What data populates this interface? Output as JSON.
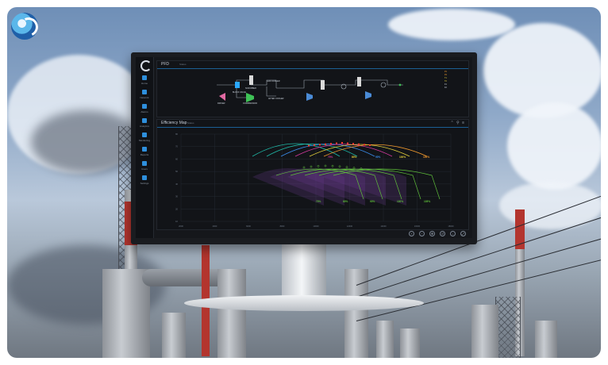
{
  "app": {
    "panels": {
      "pfd": {
        "title": "PFD",
        "subtitle": "Status"
      },
      "efficiency": {
        "title": "Efficiency Map",
        "subtitle": "Status"
      }
    },
    "sidebar": {
      "items": [
        {
          "label": "Home",
          "icon": "home-icon"
        },
        {
          "label": "Network",
          "icon": "network-icon"
        },
        {
          "label": "Alarms",
          "icon": "alarm-icon"
        },
        {
          "label": "Analytics",
          "icon": "chart-icon"
        },
        {
          "label": "Monitoring",
          "icon": "monitor-icon"
        },
        {
          "label": "Reports",
          "icon": "report-icon"
        },
        {
          "label": "Users",
          "icon": "user-icon"
        },
        {
          "label": "Settings",
          "icon": "gear-icon"
        }
      ]
    },
    "pfd_labels": {
      "block_valve": "BLOCK VALVE",
      "scrubber": "SCRUBBER",
      "gas_cooler": "GAS COOLER",
      "after_cooler": "AFTER COOLER",
      "driver": "DRIVER",
      "compressor": "COMPRESSOR"
    },
    "pfd_legend": [
      "P1",
      "P2",
      "T1",
      "T2",
      "F1",
      "F2"
    ],
    "toolbar_icons": [
      "zoom-in-icon",
      "zoom-out-icon",
      "pan-icon",
      "reset-icon",
      "download-icon",
      "fullscreen-icon"
    ]
  },
  "chart_data": {
    "type": "line",
    "x_ticks": [
      "2000",
      "4000",
      "6000",
      "8000",
      "10000",
      "12000",
      "14000",
      "16000",
      "18000"
    ],
    "y_ticks": [
      "80",
      "70",
      "60",
      "50",
      "40",
      "30",
      "20",
      "10"
    ],
    "upper_band_labels": [
      "70%",
      "80%",
      "90%",
      "100%",
      "105%"
    ],
    "lower_band_labels": [
      "70%",
      "80%",
      "90%",
      "100%",
      "105%"
    ],
    "colors": {
      "teal": "#1fb6a5",
      "blue": "#3b8ff0",
      "magenta": "#d63aa0",
      "yellow": "#e6d23c",
      "orange": "#f29a2e",
      "green": "#5fbf3a",
      "purple": "#6b3c8f",
      "marker_red": "#ff3b30"
    }
  }
}
